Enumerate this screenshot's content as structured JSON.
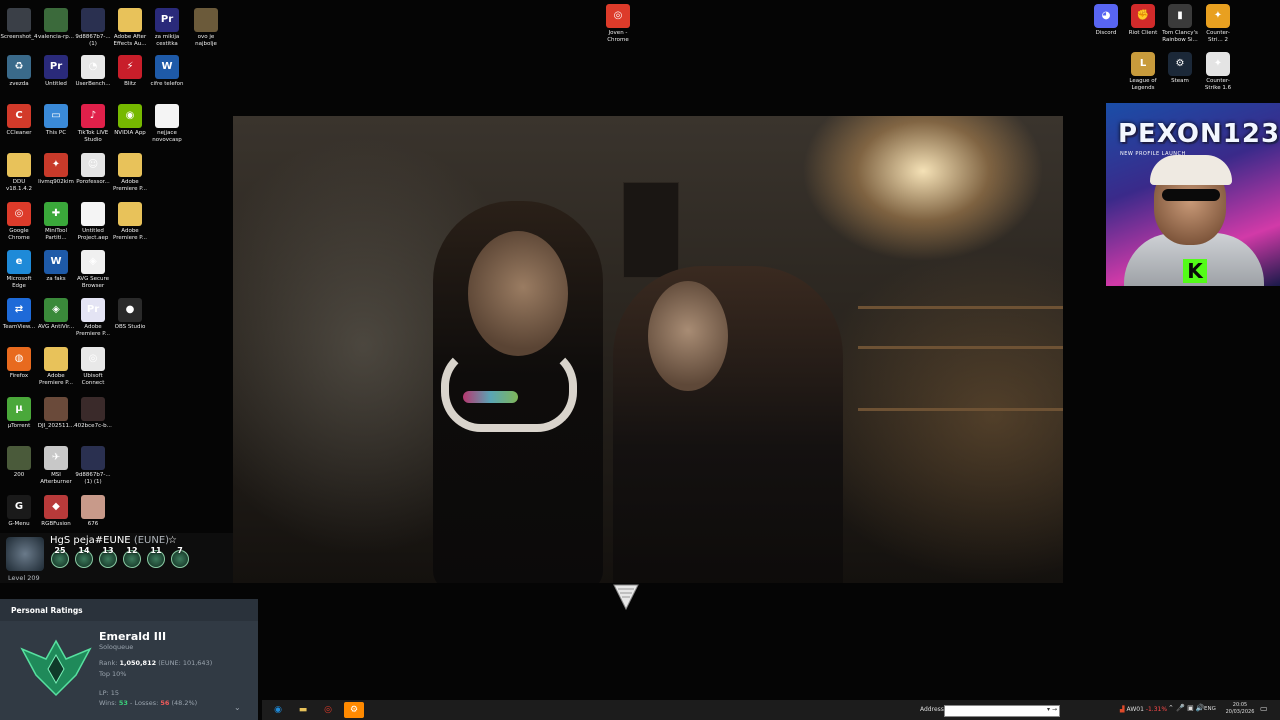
{
  "desktop_left": [
    {
      "label": "Screenshot_4",
      "icon": "screenshot-icon",
      "color": "#3a3f47",
      "glyph": ""
    },
    {
      "label": "valencia-rp...",
      "icon": "image-icon",
      "color": "#3b6a3b",
      "glyph": ""
    },
    {
      "label": "9d8867b7-... (1)",
      "icon": "image-icon",
      "color": "#2a3050",
      "glyph": ""
    },
    {
      "label": "Adobe After Effects Au...",
      "icon": "folder-icon",
      "color": "#e8c25a",
      "glyph": ""
    },
    {
      "label": "za mikija cestitka",
      "icon": "premiere-icon",
      "color": "#2a2a7a",
      "glyph": "Pr"
    },
    {
      "label": "ovo je najbolje",
      "icon": "image-icon",
      "color": "#6b5a3a",
      "glyph": ""
    },
    {
      "label": "zvezda",
      "icon": "recycle-bin-icon",
      "color": "#3a6a8a",
      "glyph": "♻"
    },
    {
      "label": "Untitled",
      "icon": "premiere-icon",
      "color": "#2a2a7a",
      "glyph": "Pr"
    },
    {
      "label": "UserBench...",
      "icon": "clock-icon",
      "color": "#e8e8e8",
      "glyph": "◔"
    },
    {
      "label": "Blitz",
      "icon": "blitz-icon",
      "color": "#c81e2a",
      "glyph": "⚡"
    },
    {
      "label": "cifre telefon",
      "icon": "word-icon",
      "color": "#1e5aa8",
      "glyph": "W"
    },
    {
      "label": "CCleaner",
      "icon": "ccleaner-icon",
      "color": "#d23a2a",
      "glyph": "C"
    },
    {
      "label": "This PC",
      "icon": "computer-icon",
      "color": "#3a8ad8",
      "glyph": "▭"
    },
    {
      "label": "TikTok LIVE Studio",
      "icon": "tiktok-icon",
      "color": "#e0204a",
      "glyph": "♪"
    },
    {
      "label": "NVIDIA App",
      "icon": "nvidia-icon",
      "color": "#76b900",
      "glyph": "◉"
    },
    {
      "label": "nejjace novovcasp",
      "icon": "document-icon",
      "color": "#f4f4f4",
      "glyph": ""
    },
    {
      "label": "DDU v18.1.4.2",
      "icon": "folder-icon",
      "color": "#e8c25a",
      "glyph": ""
    },
    {
      "label": "livmq902kim",
      "icon": "app-icon",
      "color": "#c83a2a",
      "glyph": "✦"
    },
    {
      "label": "Porofessor...",
      "icon": "porofessor-icon",
      "color": "#e4e4e4",
      "glyph": "☺"
    },
    {
      "label": "Adobe Premiere P...",
      "icon": "folder-icon",
      "color": "#e8c25a",
      "glyph": ""
    },
    {
      "label": "Google Chrome",
      "icon": "chrome-icon",
      "color": "#dd3b2a",
      "glyph": "◎"
    },
    {
      "label": "MiniTool Partiti...",
      "icon": "minitool-icon",
      "color": "#3aa83a",
      "glyph": "✚"
    },
    {
      "label": "Untitled Project.aep",
      "icon": "document-icon",
      "color": "#f4f4f4",
      "glyph": ""
    },
    {
      "label": "Adobe Premiere P...",
      "icon": "folder-icon",
      "color": "#e8c25a",
      "glyph": ""
    },
    {
      "label": "Microsoft Edge",
      "icon": "edge-icon",
      "color": "#1e8ad8",
      "glyph": "e"
    },
    {
      "label": "za faks",
      "icon": "word-icon",
      "color": "#1e5aa8",
      "glyph": "W"
    },
    {
      "label": "AVG Secure Browser",
      "icon": "avg-icon",
      "color": "#f0f0f0",
      "glyph": "◈"
    },
    {
      "label": "TeamView...",
      "icon": "teamviewer-icon",
      "color": "#1e6ad8",
      "glyph": "⇄"
    },
    {
      "label": "AVG AntiVir...",
      "icon": "avg-icon",
      "color": "#3a8a3a",
      "glyph": "◈"
    },
    {
      "label": "Adobe Premiere P...",
      "icon": "premiere-file-icon",
      "color": "#e4e4f4",
      "glyph": "Pr"
    },
    {
      "label": "OBS Studio",
      "icon": "obs-icon",
      "color": "#2a2a2a",
      "glyph": "●"
    },
    {
      "label": "Firefox",
      "icon": "firefox-icon",
      "color": "#e86a1e",
      "glyph": "◍"
    },
    {
      "label": "Adobe Premiere P...",
      "icon": "folder-icon",
      "color": "#e8c25a",
      "glyph": ""
    },
    {
      "label": "Ubisoft Connect",
      "icon": "ubisoft-icon",
      "color": "#e8e8e8",
      "glyph": "◎"
    },
    {
      "label": "µTorrent",
      "icon": "utorrent-icon",
      "color": "#4aa83a",
      "glyph": "µ"
    },
    {
      "label": "DJI_202511...",
      "icon": "video-icon",
      "color": "#6a4a3a",
      "glyph": ""
    },
    {
      "label": "402bce7c-b...",
      "icon": "image-icon",
      "color": "#3a2a2a",
      "glyph": ""
    },
    {
      "label": "200",
      "icon": "image-icon",
      "color": "#4a5a3a",
      "glyph": ""
    },
    {
      "label": "MSI Afterburner",
      "icon": "msi-icon",
      "color": "#c8c8c8",
      "glyph": "✈"
    },
    {
      "label": "9d8867b7-... (1) (1)",
      "icon": "image-icon",
      "color": "#2a3050",
      "glyph": ""
    },
    {
      "label": "G-Menu",
      "icon": "gmenu-icon",
      "color": "#1a1a1a",
      "glyph": "G"
    },
    {
      "label": "RGBFusion",
      "icon": "rgb-fusion-icon",
      "color": "#b83a3a",
      "glyph": "◆"
    },
    {
      "label": "676",
      "icon": "image-icon",
      "color": "#c89a8a",
      "glyph": ""
    }
  ],
  "desktop_top": [
    {
      "label": "Joven - Chrome",
      "icon": "chrome-icon",
      "color": "#dd3b2a",
      "glyph": "◎"
    }
  ],
  "desktop_right": [
    {
      "label": "Discord",
      "icon": "discord-icon",
      "color": "#5865f2",
      "glyph": "◕"
    },
    {
      "label": "Riot Client",
      "icon": "riot-icon",
      "color": "#d12a2a",
      "glyph": "✊"
    },
    {
      "label": "Tom Clancy's Rainbow Si...",
      "icon": "rainbow-six-icon",
      "color": "#3a3a3a",
      "glyph": "▮"
    },
    {
      "label": "Counter-Stri... 2",
      "icon": "cs2-icon",
      "color": "#e8a020",
      "glyph": "✦"
    },
    {
      "label": "League of Legends",
      "icon": "lol-icon",
      "color": "#c89b3c",
      "glyph": "L"
    },
    {
      "label": "Steam",
      "icon": "steam-icon",
      "color": "#1b2838",
      "glyph": "⚙"
    },
    {
      "label": "Counter-Strike 1.6",
      "icon": "cs16-icon",
      "color": "#e4e4e4",
      "glyph": "✦"
    }
  ],
  "promo": {
    "title": "PEXON123",
    "subtitle": "NEW PROFILE LAUNCH",
    "kick_glyph": "K"
  },
  "rank_widget": {
    "summoner": "HgS peja#EUNE",
    "region": "(EUNE)",
    "level": "Level 209",
    "mastery": [
      "25",
      "14",
      "13",
      "12",
      "11",
      "7"
    ],
    "section_title": "Personal Ratings",
    "tier": "Emerald III",
    "queue": "Soloqueue",
    "rank_label": "Rank:",
    "rank_value": "1,050,812",
    "rank_region": "(EUNE: 101,643)",
    "top": "Top 10%",
    "lp": "LP: 15",
    "wins_label": "Wins:",
    "wins": "53",
    "losses_label": "Losses:",
    "losses": "56",
    "winrate": "(48.2%)"
  },
  "taskbar": {
    "address_label": "Address",
    "address_value": "",
    "stock_ticker": "AW01",
    "stock_change": "-1.31%",
    "language": "ENG",
    "time": "20:05",
    "date": "20/03/2026"
  },
  "colors": {
    "emerald": "#3ad07a",
    "loss": "#f05a5a",
    "accent": "#ff8a00"
  }
}
